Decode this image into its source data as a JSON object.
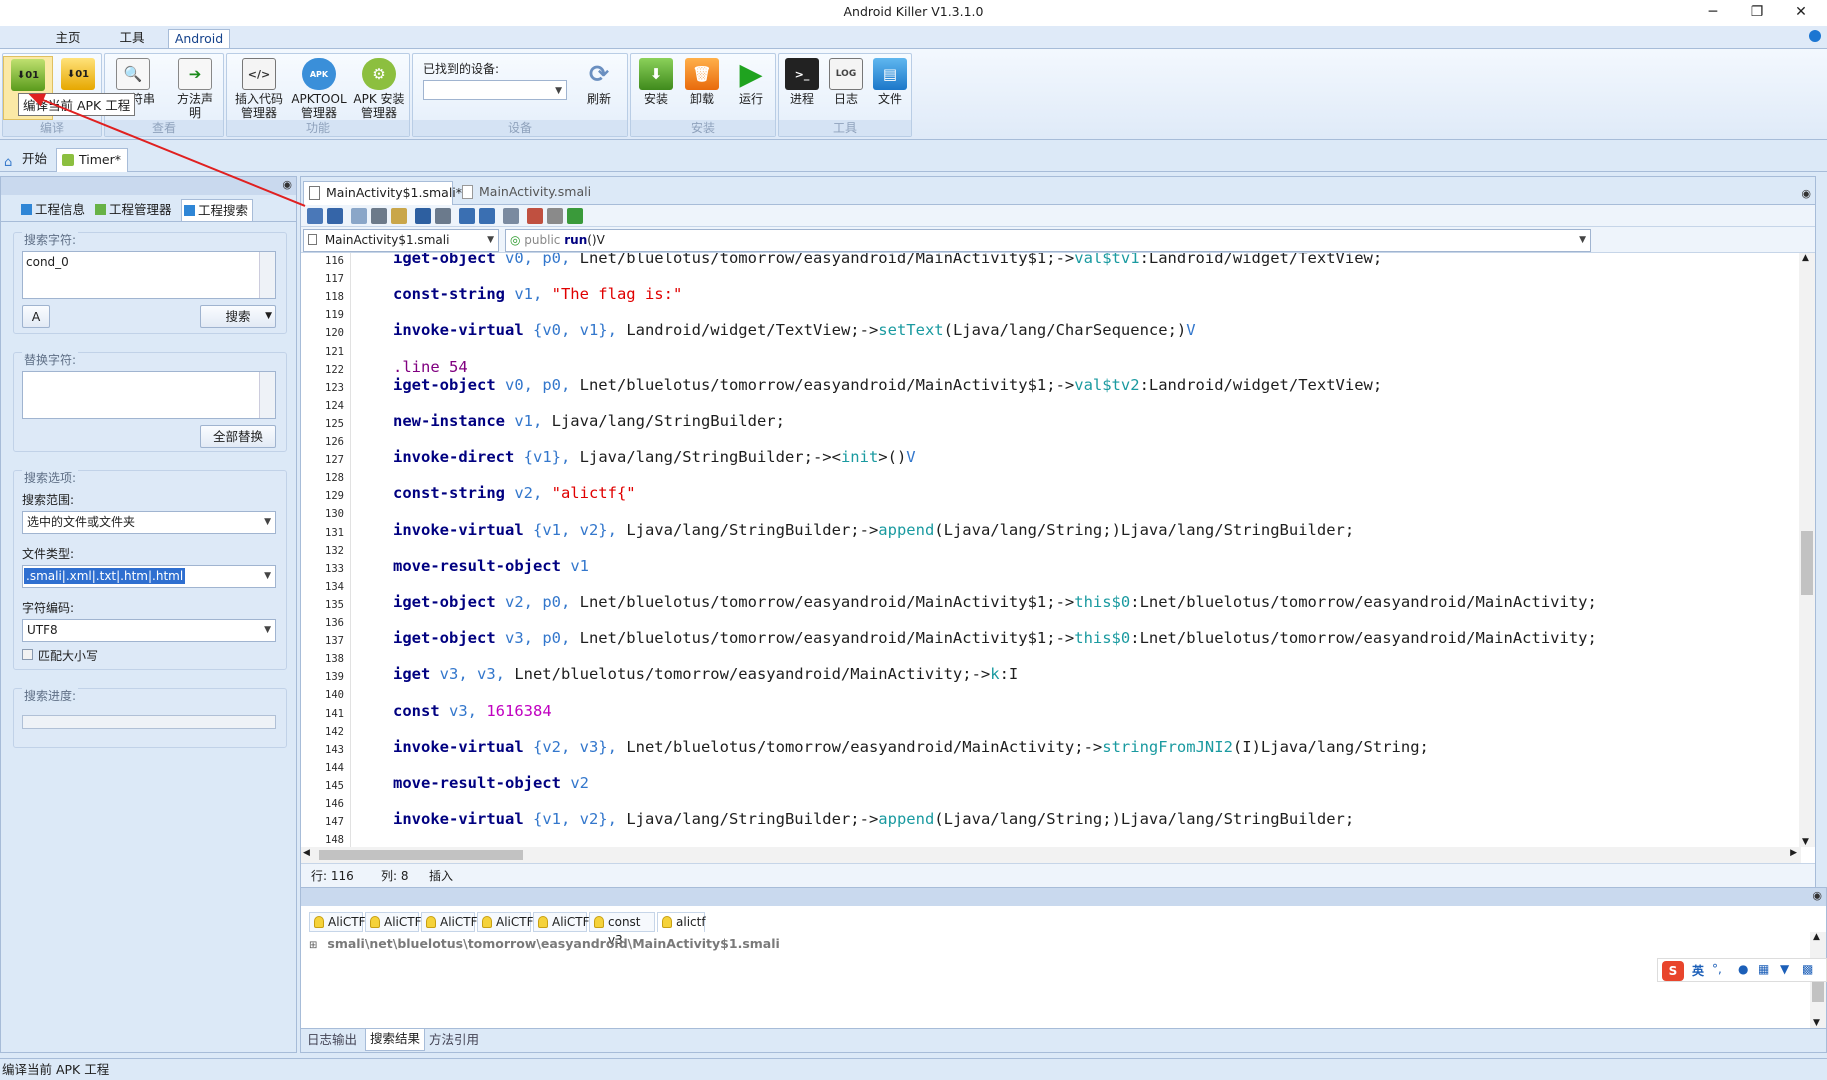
{
  "window": {
    "title": "Android Killer V1.3.1.0",
    "minimize": "─",
    "restore": "❐",
    "close": "✕"
  },
  "ribbon_tabs": [
    "主页",
    "工具",
    "Android"
  ],
  "ribbon": {
    "compile_group": {
      "title": "编译",
      "buttons": [
        "编译",
        "反编译"
      ]
    },
    "view_group": {
      "title": "查看",
      "buttons": [
        "字符串",
        "方法声明"
      ],
      "method_decl": "方法声\n明",
      "string_label": "符串"
    },
    "feature_group": {
      "title": "功能",
      "buttons": [
        "插入代码管理器",
        "APKTOOL管理器",
        "APK 安装管理器"
      ],
      "b1": [
        "插入代码",
        "管理器"
      ],
      "b2": [
        "APKTOOL",
        "管理器"
      ],
      "b3": [
        "APK 安装",
        "管理器"
      ]
    },
    "device_group": {
      "title": "设备",
      "label": "已找到的设备:",
      "value": "",
      "refresh": "刷新"
    },
    "install_group": {
      "title": "安装",
      "buttons": [
        "安装",
        "卸载",
        "运行"
      ]
    },
    "tools_group": {
      "title": "工具",
      "buttons": [
        "进程",
        "日志",
        "文件"
      ]
    }
  },
  "tooltip": "编译当前 APK 工程",
  "compile_label_partial": "编",
  "doc_tabs": [
    "开始",
    "Timer*"
  ],
  "left": {
    "tabs": [
      "工程信息",
      "工程管理器",
      "工程搜索"
    ],
    "search_label": "搜索字符:",
    "search_value": "cond_0",
    "search_btn": "搜索",
    "replace_label": "替换字符:",
    "replace_value": "",
    "replace_all_btn": "全部替换",
    "options_label": "搜索选项:",
    "scope_label": "搜索范围:",
    "scope_value": "选中的文件或文件夹",
    "filetype_label": "文件类型:",
    "filetype_value": ".smali|.xml|.txt|.htm|.html",
    "encoding_label": "字符编码:",
    "encoding_value": "UTF8",
    "match_case": "匹配大小写",
    "progress_label": "搜索进度:",
    "progress": 0
  },
  "editor": {
    "tabs": [
      "MainActivity$1.smali*",
      "MainActivity.smali"
    ],
    "file_select": "MainActivity$1.smali",
    "method_select_kw": "public",
    "method_select_name": "run",
    "method_select_sig": "()V",
    "status_row": "行: 116",
    "status_col": "列: 8",
    "status_mode": "插入",
    "line_numbers": [
      "116",
      "117",
      "118",
      "119",
      "120",
      "121",
      "122",
      "123",
      "124",
      "125",
      "126",
      "127",
      "128",
      "129",
      "130",
      "131",
      "132",
      "133",
      "134",
      "135",
      "136",
      "137",
      "138",
      "139",
      "140",
      "141",
      "142",
      "143",
      "144",
      "145",
      "146",
      "147",
      "148"
    ]
  },
  "code_lines": [
    {
      "line": 116,
      "parts": [
        [
          "kw",
          "iget-object"
        ],
        [
          "",
          ""
        ],
        [
          "rg",
          " v0, p0,"
        ],
        [
          "",
          " Lnet/bluelotus/tomorrow/easyandroid/MainActivity$1;->"
        ],
        [
          "mt",
          "val$tv1"
        ],
        [
          "",
          ":Landroid/widget/TextView;"
        ]
      ]
    },
    {
      "line": 118,
      "parts": [
        [
          "kw",
          "const-string"
        ],
        [
          "rg",
          " v1,"
        ],
        [
          "st",
          " \"The flag is:\""
        ]
      ]
    },
    {
      "line": 120,
      "parts": [
        [
          "kw",
          "invoke-virtual"
        ],
        [
          "rg",
          " {v0, v1},"
        ],
        [
          "",
          " Landroid/widget/TextView;->"
        ],
        [
          "mt",
          "setText"
        ],
        [
          "",
          "(Ljava/lang/CharSequence;)"
        ],
        [
          "rg",
          "V"
        ]
      ]
    },
    {
      "line": 122,
      "parts": [
        [
          "lb2",
          ".line 54"
        ]
      ]
    },
    {
      "line": 123,
      "parts": [
        [
          "kw",
          "iget-object"
        ],
        [
          "rg",
          " v0, p0,"
        ],
        [
          "",
          " Lnet/bluelotus/tomorrow/easyandroid/MainActivity$1;->"
        ],
        [
          "mt",
          "val$tv2"
        ],
        [
          "",
          ":Landroid/widget/TextView;"
        ]
      ]
    },
    {
      "line": 125,
      "parts": [
        [
          "kw",
          "new-instance"
        ],
        [
          "rg",
          " v1,"
        ],
        [
          "",
          " Ljava/lang/StringBuilder;"
        ]
      ]
    },
    {
      "line": 127,
      "parts": [
        [
          "kw",
          "invoke-direct"
        ],
        [
          "rg",
          " {v1},"
        ],
        [
          "",
          " Ljava/lang/StringBuilder;-><"
        ],
        [
          "mt",
          "init"
        ],
        [
          "",
          ">()"
        ],
        [
          "rg",
          "V"
        ]
      ]
    },
    {
      "line": 129,
      "parts": [
        [
          "kw",
          "const-string"
        ],
        [
          "rg",
          " v2,"
        ],
        [
          "st",
          " \"alictf{\""
        ]
      ]
    },
    {
      "line": 131,
      "parts": [
        [
          "kw",
          "invoke-virtual"
        ],
        [
          "rg",
          " {v1, v2},"
        ],
        [
          "",
          " Ljava/lang/StringBuilder;->"
        ],
        [
          "mt",
          "append"
        ],
        [
          "",
          "(Ljava/lang/String;)Ljava/lang/StringBuilder;"
        ]
      ]
    },
    {
      "line": 133,
      "parts": [
        [
          "kw",
          "move-result-object"
        ],
        [
          "rg",
          " v1"
        ]
      ]
    },
    {
      "line": 135,
      "parts": [
        [
          "kw",
          "iget-object"
        ],
        [
          "rg",
          " v2, p0,"
        ],
        [
          "",
          " Lnet/bluelotus/tomorrow/easyandroid/MainActivity$1;->"
        ],
        [
          "mt",
          "this$0"
        ],
        [
          "",
          ":Lnet/bluelotus/tomorrow/easyandroid/MainActivity;"
        ]
      ]
    },
    {
      "line": 137,
      "parts": [
        [
          "kw",
          "iget-object"
        ],
        [
          "rg",
          " v3, p0,"
        ],
        [
          "",
          " Lnet/bluelotus/tomorrow/easyandroid/MainActivity$1;->"
        ],
        [
          "mt",
          "this$0"
        ],
        [
          "",
          ":Lnet/bluelotus/tomorrow/easyandroid/MainActivity;"
        ]
      ]
    },
    {
      "line": 139,
      "parts": [
        [
          "kw",
          "iget"
        ],
        [
          "rg",
          " v3, v3,"
        ],
        [
          "",
          " Lnet/bluelotus/tomorrow/easyandroid/MainActivity;->"
        ],
        [
          "mt",
          "k"
        ],
        [
          "",
          ":I"
        ]
      ]
    },
    {
      "line": 141,
      "parts": [
        [
          "kw",
          "const"
        ],
        [
          "rg",
          " v3,"
        ],
        [
          "nm",
          " 1616384"
        ]
      ]
    },
    {
      "line": 143,
      "parts": [
        [
          "kw",
          "invoke-virtual"
        ],
        [
          "rg",
          " {v2, v3},"
        ],
        [
          "",
          " Lnet/bluelotus/tomorrow/easyandroid/MainActivity;->"
        ],
        [
          "mt",
          "stringFromJNI2"
        ],
        [
          "",
          "(I)Ljava/lang/String;"
        ]
      ]
    },
    {
      "line": 145,
      "parts": [
        [
          "kw",
          "move-result-object"
        ],
        [
          "rg",
          " v2"
        ]
      ]
    },
    {
      "line": 147,
      "parts": [
        [
          "kw",
          "invoke-virtual"
        ],
        [
          "rg",
          " {v1, v2},"
        ],
        [
          "",
          " Ljava/lang/StringBuilder;->"
        ],
        [
          "mt",
          "append"
        ],
        [
          "",
          "(Ljava/lang/String;)Ljava/lang/StringBuilder;"
        ]
      ]
    }
  ],
  "bottom": {
    "result_tabs": [
      "AliCTF",
      "AliCTF",
      "AliCTF",
      "AliCTF",
      "AliCTF",
      "const v3",
      "alictf"
    ],
    "tree_item": "smali\\net\\bluelotus\\tomorrow\\easyandroid\\MainActivity$1.smali",
    "panel_tabs": [
      "日志输出",
      "搜索结果",
      "方法引用"
    ],
    "ime": [
      "英",
      "°,"
    ]
  },
  "statusbar": {
    "text": "编译当前 APK 工程"
  },
  "colors": {
    "accent": "#15428b",
    "panel_bg": "#dce9f7",
    "annotation_arrow": "#e02020"
  }
}
